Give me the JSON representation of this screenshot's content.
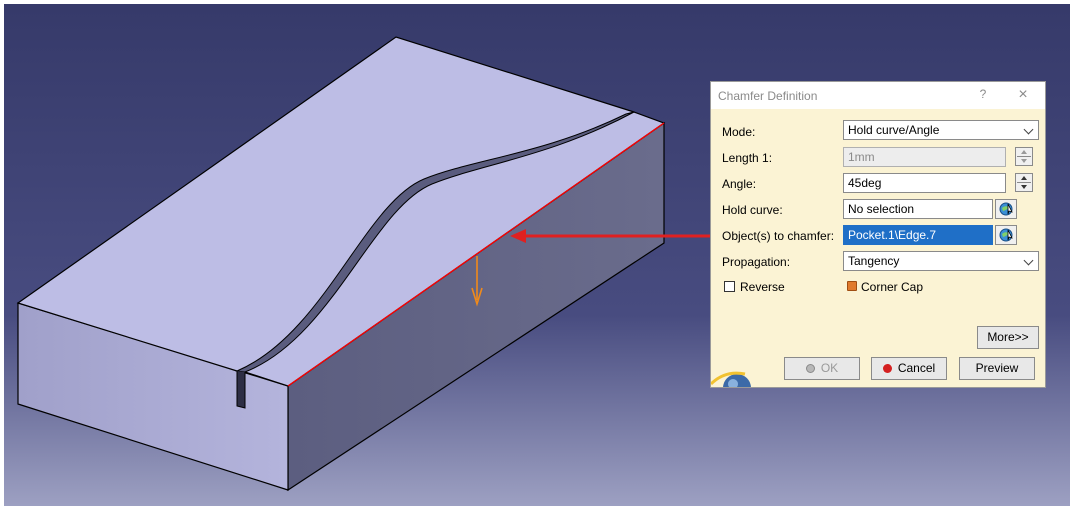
{
  "dialog": {
    "title": "Chamfer Definition",
    "help": "?",
    "close": "×",
    "mode": {
      "label": "Mode:",
      "value": "Hold curve/Angle"
    },
    "length1": {
      "label": "Length 1:",
      "value": "1mm"
    },
    "angle": {
      "label": "Angle:",
      "value": "45deg"
    },
    "hold_curve": {
      "label": "Hold curve:",
      "value": "No selection"
    },
    "objects": {
      "label": "Object(s) to chamfer:",
      "value": "Pocket.1\\Edge.7"
    },
    "propagation": {
      "label": "Propagation:",
      "value": "Tangency"
    },
    "reverse": {
      "label": "Reverse",
      "checked": false
    },
    "corner_cap": {
      "label": "Corner Cap"
    },
    "buttons": {
      "more": "More>>",
      "ok": "OK",
      "cancel": "Cancel",
      "preview": "Preview"
    }
  },
  "colors": {
    "viewport_top": "#363a6a",
    "viewport_bottom": "#9da0c2",
    "top_face": "#bdbde5",
    "front_face": "#a3a3cc",
    "side_face": "#636585",
    "selected_edge": "#ff0000",
    "arrow": "#e02020",
    "direction_arrow": "#f08a1a",
    "dialog_bg": "#fbf3d4",
    "selection": "#1f6fc7"
  },
  "icons": {
    "selection_button": "select-element-icon",
    "ok": "green-dot-icon",
    "cancel": "red-dot-icon",
    "corner_cap": "corner-cap-icon"
  }
}
